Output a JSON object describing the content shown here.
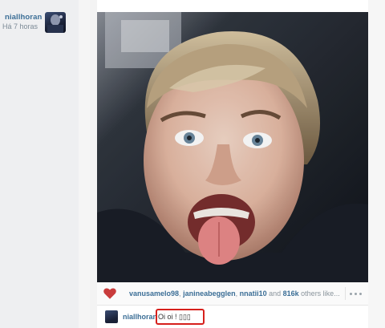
{
  "post": {
    "username": "niallhoran",
    "time_ago": "Há 7 horas",
    "likes": {
      "user1": "vanusamelo98",
      "sep1": ", ",
      "user2": "janineabegglen",
      "sep2": ", ",
      "user3": "nnatii10",
      "and_text": " and ",
      "count": "816k",
      "others_text": " others like..."
    },
    "comment": {
      "username": "niallhoran",
      "text": "Oi oi ! ▯▯▯"
    }
  },
  "icons": {
    "heart": "heart-icon",
    "more": "more-options-icon",
    "avatar": "avatar"
  },
  "colors": {
    "username_link": "#3b6e96",
    "heart": "#c93c3c",
    "highlight_box": "#d6201c"
  }
}
